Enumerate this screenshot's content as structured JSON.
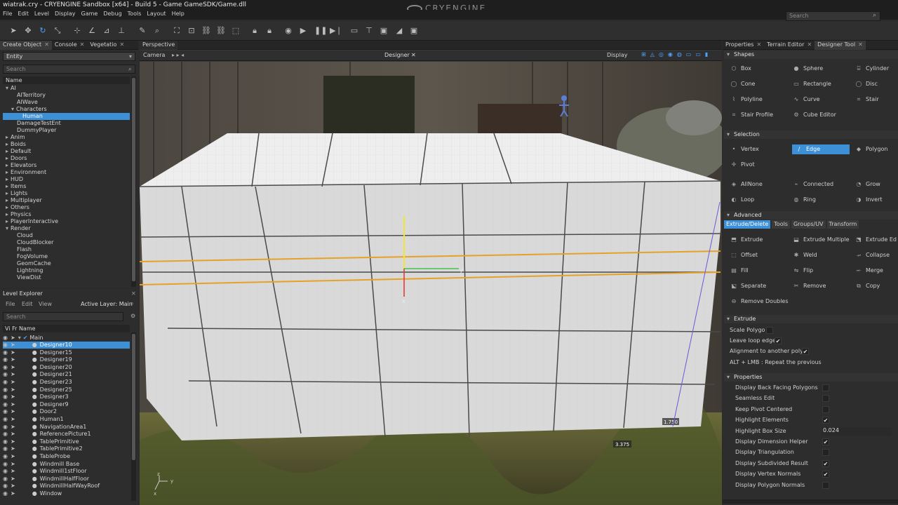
{
  "title": "wiatrak.cry - CRYENGINE Sandbox  [x64] - Build 5 - Game GameSDK/Game.dll",
  "logo": "CRYENGINE",
  "menu": [
    "File",
    "Edit",
    "Level",
    "Display",
    "Game",
    "Debug",
    "Tools",
    "Layout",
    "Help"
  ],
  "search_placeholder": "Search",
  "left_tabs": [
    "Create Object",
    "Console",
    "Vegetatio"
  ],
  "entity_dropdown": "Entity",
  "create_search": "Search",
  "name_header": "Name",
  "create_tree": [
    {
      "t": "AI",
      "lvl": 0,
      "sel": false,
      "ex": true
    },
    {
      "t": "AITerritory",
      "lvl": 2,
      "sel": false
    },
    {
      "t": "AIWave",
      "lvl": 2,
      "sel": false
    },
    {
      "t": "Characters",
      "lvl": 1,
      "sel": false,
      "ex": true
    },
    {
      "t": "Human",
      "lvl": 3,
      "sel": true
    },
    {
      "t": "DamageTestEnt",
      "lvl": 2,
      "sel": false
    },
    {
      "t": "DummyPlayer",
      "lvl": 2,
      "sel": false
    },
    {
      "t": "Anim",
      "lvl": 0,
      "sel": false,
      "col": true
    },
    {
      "t": "Boids",
      "lvl": 0,
      "sel": false,
      "col": true
    },
    {
      "t": "Default",
      "lvl": 0,
      "sel": false,
      "col": true
    },
    {
      "t": "Doors",
      "lvl": 0,
      "sel": false,
      "col": true
    },
    {
      "t": "Elevators",
      "lvl": 0,
      "sel": false,
      "col": true
    },
    {
      "t": "Environment",
      "lvl": 0,
      "sel": false,
      "col": true
    },
    {
      "t": "HUD",
      "lvl": 0,
      "sel": false,
      "col": true
    },
    {
      "t": "Items",
      "lvl": 0,
      "sel": false,
      "col": true
    },
    {
      "t": "Lights",
      "lvl": 0,
      "sel": false,
      "col": true
    },
    {
      "t": "Multiplayer",
      "lvl": 0,
      "sel": false,
      "col": true
    },
    {
      "t": "Others",
      "lvl": 0,
      "sel": false,
      "col": true
    },
    {
      "t": "Physics",
      "lvl": 0,
      "sel": false,
      "col": true
    },
    {
      "t": "PlayerInteractive",
      "lvl": 0,
      "sel": false,
      "col": true
    },
    {
      "t": "Render",
      "lvl": 0,
      "sel": false,
      "ex": true
    },
    {
      "t": "Cloud",
      "lvl": 2,
      "sel": false
    },
    {
      "t": "CloudBlocker",
      "lvl": 2,
      "sel": false
    },
    {
      "t": "Flash",
      "lvl": 2,
      "sel": false
    },
    {
      "t": "FogVolume",
      "lvl": 2,
      "sel": false
    },
    {
      "t": "GeomCache",
      "lvl": 2,
      "sel": false
    },
    {
      "t": "Lightning",
      "lvl": 2,
      "sel": false
    },
    {
      "t": "ViewDist",
      "lvl": 2,
      "sel": false
    }
  ],
  "level_explorer": {
    "title": "Level Explorer",
    "menu": [
      "File",
      "Edit",
      "View"
    ],
    "active_layer": "Active Layer: Main",
    "search": "Search",
    "cols": [
      "Vi",
      "Fr",
      "Name"
    ],
    "root": "Main",
    "items": [
      "Designer10",
      "Designer15",
      "Designer19",
      "Designer20",
      "Designer21",
      "Designer23",
      "Designer25",
      "Designer3",
      "Designer9",
      "Door2",
      "Human1",
      "NavigationArea1",
      "ReferencePicture1",
      "TablePrimitive",
      "TablePrimitive2",
      "TableProbe",
      "Windmill Base",
      "Windmill1stFloor",
      "WindmillHalfFloor",
      "WindmillHalfWayRoof",
      "Window"
    ]
  },
  "viewport": {
    "tab": "Perspective",
    "camera": "Camera",
    "mode": "Designer",
    "display": "Display",
    "dim1": "1.750",
    "dim2": "3.375",
    "axis_x": "x",
    "axis_y": "y",
    "axis_z": "z"
  },
  "right_tabs": [
    "Properties",
    "Terrain Editor",
    "Designer Tool"
  ],
  "designer": {
    "shapes_title": "Shapes",
    "shapes": [
      [
        "Box",
        "Sphere",
        "Cylinder"
      ],
      [
        "Cone",
        "Rectangle",
        "Disc"
      ],
      [
        "Polyline",
        "Curve",
        "Stair"
      ],
      [
        "Stair Profile",
        "Cube Editor",
        ""
      ]
    ],
    "selection_title": "Selection",
    "selection": [
      [
        "Vertex",
        "Edge",
        "Polygon"
      ],
      [
        "Pivot",
        "",
        ""
      ]
    ],
    "selection2": [
      [
        "AllNone",
        "Connected",
        "Grow"
      ],
      [
        "Loop",
        "Ring",
        "Invert"
      ]
    ],
    "advanced_title": "Advanced",
    "adv_tabs": [
      "Extrude/Delete",
      "Tools",
      "Groups/UV",
      "Transform"
    ],
    "adv_tools": [
      [
        "Extrude",
        "Extrude Multiple",
        "Extrude Ed"
      ],
      [
        "Offset",
        "Weld",
        "Collapse"
      ],
      [
        "Fill",
        "Flip",
        "Merge"
      ],
      [
        "Separate",
        "Remove",
        "Copy"
      ],
      [
        "Remove Doubles",
        "",
        ""
      ]
    ],
    "extrude_title": "Extrude",
    "extrude_opts": [
      "Scale Polygo",
      "Leave loop edge",
      "Alignment to another polyg"
    ],
    "extrude_hint": "ALT + LMB : Repeat the previous",
    "props_title": "Properties",
    "props": [
      {
        "l": "Display Back Facing Polygons",
        "v": ""
      },
      {
        "l": "Seamless Edit",
        "v": ""
      },
      {
        "l": "Keep Pivot Centered",
        "v": ""
      },
      {
        "l": "Highlight Elements",
        "v": "✔"
      },
      {
        "l": "Highlight Box Size",
        "v": "0.024"
      },
      {
        "l": "Display Dimension Helper",
        "v": "✔"
      },
      {
        "l": "Display Triangulation",
        "v": ""
      },
      {
        "l": "Display Subdivided Result",
        "v": "✔"
      },
      {
        "l": "Display Vertex Normals",
        "v": "✔"
      },
      {
        "l": "Display Polygon Normals",
        "v": ""
      }
    ]
  }
}
